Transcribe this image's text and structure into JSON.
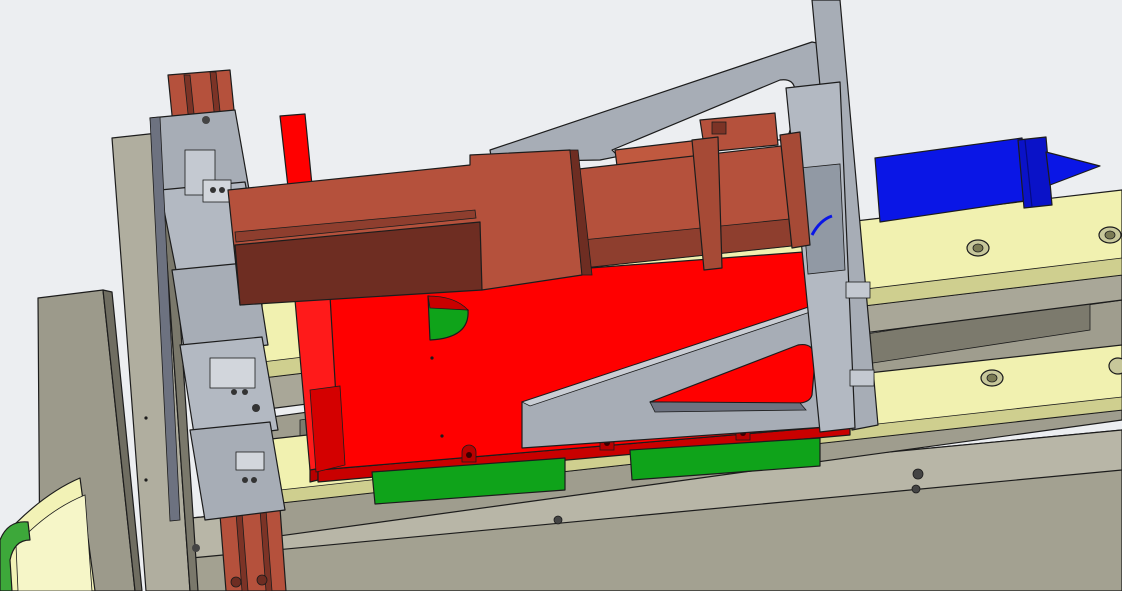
{
  "colors": {
    "background": "#eceef1",
    "frame_gray": "#9a9888",
    "frame_light": "#b9b7a8",
    "frame_dark": "#6f6d61",
    "rail_yellow": "#f2f2b6",
    "rail_yellow_dark": "#c9c98a",
    "plate_red": "#ff0000",
    "plate_red_dark": "#c90000",
    "motor_brown": "#b5513c",
    "motor_brown_dark": "#6e2d22",
    "bracket_gray": "#a7adb6",
    "bracket_gray_dark": "#6d7280",
    "pad_green": "#0fa31a",
    "tool_blue": "#0a16e6",
    "clamp_green": "#3da83a",
    "ring_yellow": "#f2f2b6"
  },
  "icons": {
    "hole": "circle-hole",
    "bolt": "counterbore-bolt"
  }
}
